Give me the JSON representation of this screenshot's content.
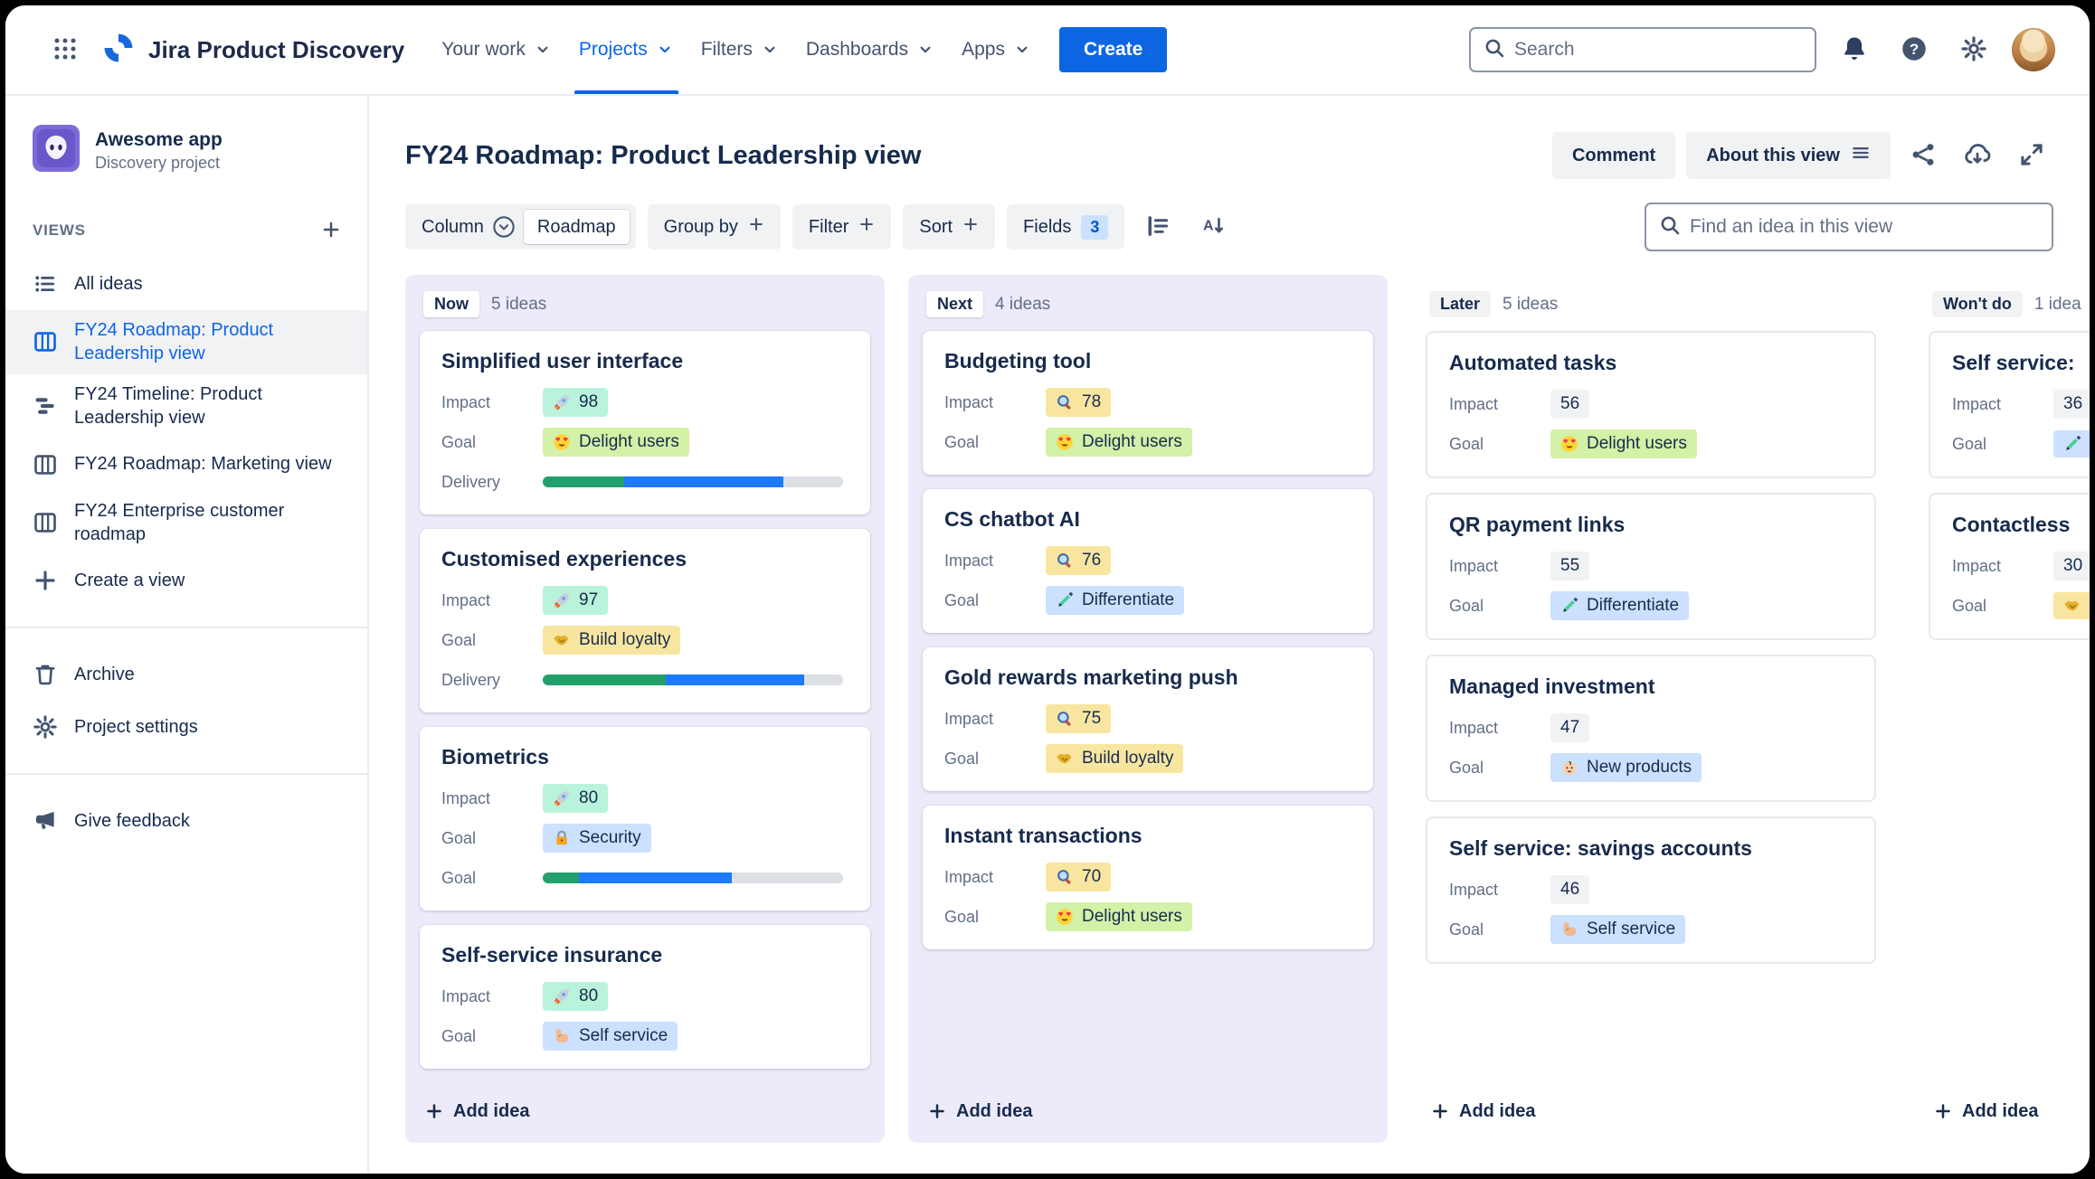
{
  "topnav": {
    "app_title": "Jira Product Discovery",
    "items": [
      {
        "label": "Your work"
      },
      {
        "label": "Projects",
        "active": true
      },
      {
        "label": "Filters"
      },
      {
        "label": "Dashboards"
      },
      {
        "label": "Apps"
      }
    ],
    "create_label": "Create",
    "search_placeholder": "Search"
  },
  "sidebar": {
    "project_name": "Awesome app",
    "project_type": "Discovery project",
    "views_label": "VIEWS",
    "items": [
      {
        "label": "All ideas",
        "icon": "list-icon"
      },
      {
        "label": "FY24 Roadmap: Product Leadership view",
        "icon": "board-icon",
        "selected": true
      },
      {
        "label": "FY24 Timeline: Product Leadership view",
        "icon": "timeline-icon"
      },
      {
        "label": "FY24 Roadmap: Marketing view",
        "icon": "board-icon"
      },
      {
        "label": "FY24 Enterprise customer roadmap",
        "icon": "board-icon"
      },
      {
        "label": "Create a view",
        "icon": "plus-icon"
      }
    ],
    "archive_label": "Archive",
    "settings_label": "Project settings",
    "feedback_label": "Give feedback"
  },
  "view_header": {
    "title": "FY24 Roadmap: Product Leadership view",
    "comment_label": "Comment",
    "about_label": "About this view"
  },
  "toolbar": {
    "column_label": "Column",
    "column_value": "Roadmap",
    "group_by_label": "Group by",
    "filter_label": "Filter",
    "sort_label": "Sort",
    "fields_label": "Fields",
    "fields_count": "3",
    "find_placeholder": "Find an idea in this view"
  },
  "board": {
    "add_label": "Add idea",
    "colors": {
      "accent": "#0C66E4",
      "column_tint": "#EDEBFA",
      "impact_green": "#BAF3DB",
      "impact_yellow": "#F8E6A0",
      "impact_neutral": "#F1F2F4",
      "goal_lime": "#D3F1A7",
      "goal_yellow": "#F8E6A0",
      "goal_blue": "#CCE0FF",
      "progress_done": "#22A06B",
      "progress_active": "#1D7AFC",
      "progress_track": "#DCDFE4"
    },
    "columns": [
      {
        "name": "Now",
        "count": "5 ideas",
        "style": "purple",
        "cards": [
          {
            "title": "Simplified user interface",
            "fields": [
              {
                "label": "Impact",
                "icon": "rocket",
                "value": "98",
                "bg": "#BAF3DB"
              },
              {
                "label": "Goal",
                "icon": "heart-eyes",
                "value": "Delight users",
                "bg": "#D3F1A7"
              },
              {
                "label": "Delivery",
                "type": "progress",
                "segments": [
                  {
                    "color": "#22A06B",
                    "pct": 27
                  },
                  {
                    "color": "#1D7AFC",
                    "pct": 53
                  },
                  {
                    "color": "#DCDFE4",
                    "pct": 20
                  }
                ]
              }
            ]
          },
          {
            "title": "Customised experiences",
            "fields": [
              {
                "label": "Impact",
                "icon": "rocket",
                "value": "97",
                "bg": "#BAF3DB"
              },
              {
                "label": "Goal",
                "icon": "handshake",
                "value": "Build loyalty",
                "bg": "#F8E6A0"
              },
              {
                "label": "Delivery",
                "type": "progress",
                "segments": [
                  {
                    "color": "#22A06B",
                    "pct": 41
                  },
                  {
                    "color": "#1D7AFC",
                    "pct": 46
                  },
                  {
                    "color": "#DCDFE4",
                    "pct": 13
                  }
                ]
              }
            ]
          },
          {
            "title": "Biometrics",
            "fields": [
              {
                "label": "Impact",
                "icon": "rocket",
                "value": "80",
                "bg": "#BAF3DB"
              },
              {
                "label": "Goal",
                "icon": "lock",
                "value": "Security",
                "bg": "#CCE0FF"
              },
              {
                "label": "Goal",
                "type": "progress",
                "segments": [
                  {
                    "color": "#22A06B",
                    "pct": 12
                  },
                  {
                    "color": "#1D7AFC",
                    "pct": 51
                  },
                  {
                    "color": "#DCDFE4",
                    "pct": 37
                  }
                ]
              }
            ]
          },
          {
            "title": "Self-service insurance",
            "fields": [
              {
                "label": "Impact",
                "icon": "rocket",
                "value": "80",
                "bg": "#BAF3DB"
              },
              {
                "label": "Goal",
                "icon": "muscle",
                "value": "Self service",
                "bg": "#CCE0FF"
              }
            ]
          }
        ]
      },
      {
        "name": "Next",
        "count": "4 ideas",
        "style": "purple",
        "cards": [
          {
            "title": "Budgeting tool",
            "fields": [
              {
                "label": "Impact",
                "icon": "magnifier",
                "value": "78",
                "bg": "#F8E6A0"
              },
              {
                "label": "Goal",
                "icon": "heart-eyes",
                "value": "Delight users",
                "bg": "#D3F1A7"
              }
            ]
          },
          {
            "title": "CS chatbot AI",
            "fields": [
              {
                "label": "Impact",
                "icon": "magnifier",
                "value": "76",
                "bg": "#F8E6A0"
              },
              {
                "label": "Goal",
                "icon": "pen",
                "value": "Differentiate",
                "bg": "#CCE0FF"
              }
            ]
          },
          {
            "title": "Gold rewards marketing push",
            "fields": [
              {
                "label": "Impact",
                "icon": "magnifier",
                "value": "75",
                "bg": "#F8E6A0"
              },
              {
                "label": "Goal",
                "icon": "handshake",
                "value": "Build loyalty",
                "bg": "#F8E6A0"
              }
            ]
          },
          {
            "title": "Instant transactions",
            "fields": [
              {
                "label": "Impact",
                "icon": "magnifier",
                "value": "70",
                "bg": "#F8E6A0"
              },
              {
                "label": "Goal",
                "icon": "heart-eyes",
                "value": "Delight users",
                "bg": "#D3F1A7"
              }
            ]
          }
        ]
      },
      {
        "name": "Later",
        "count": "5 ideas",
        "style": "plain",
        "cards": [
          {
            "title": "Automated tasks",
            "fields": [
              {
                "label": "Impact",
                "value": "56",
                "bg": "#F1F2F4"
              },
              {
                "label": "Goal",
                "icon": "heart-eyes",
                "value": "Delight users",
                "bg": "#D3F1A7"
              }
            ]
          },
          {
            "title": "QR payment links",
            "fields": [
              {
                "label": "Impact",
                "value": "55",
                "bg": "#F1F2F4"
              },
              {
                "label": "Goal",
                "icon": "pen",
                "value": "Differentiate",
                "bg": "#CCE0FF"
              }
            ]
          },
          {
            "title": "Managed investment",
            "fields": [
              {
                "label": "Impact",
                "value": "47",
                "bg": "#F1F2F4"
              },
              {
                "label": "Goal",
                "icon": "baby",
                "value": "New products",
                "bg": "#CCE0FF"
              }
            ]
          },
          {
            "title": "Self service: savings accounts",
            "fields": [
              {
                "label": "Impact",
                "value": "46",
                "bg": "#F1F2F4"
              },
              {
                "label": "Goal",
                "icon": "muscle",
                "value": "Self service",
                "bg": "#CCE0FF"
              }
            ]
          }
        ]
      },
      {
        "name": "Won't do",
        "count": "1 idea",
        "style": "plain",
        "cards": [
          {
            "title": "Self service:",
            "fields": [
              {
                "label": "Impact",
                "value": "36",
                "bg": "#F1F2F4"
              },
              {
                "label": "Goal",
                "icon": "pen",
                "value": "",
                "bg": "#CCE0FF"
              }
            ]
          },
          {
            "title": "Contactless",
            "fields": [
              {
                "label": "Impact",
                "value": "30",
                "bg": "#F1F2F4"
              },
              {
                "label": "Goal",
                "icon": "handshake",
                "value": "",
                "bg": "#F8E6A0"
              }
            ]
          }
        ]
      }
    ]
  }
}
